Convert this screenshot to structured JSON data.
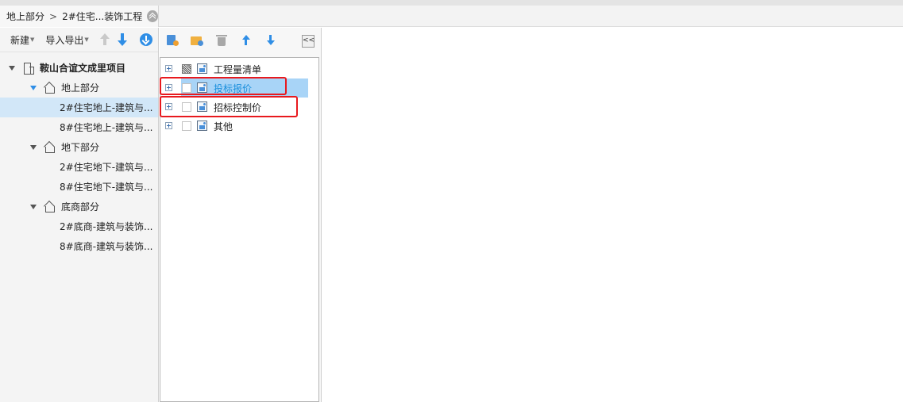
{
  "breadcrumb": {
    "root": "地上部分",
    "separator": ">",
    "current": "2#住宅...装饰工程",
    "collapse_icon": "double-chevron-up-icon"
  },
  "left_toolbar": {
    "new_label": "新建",
    "import_export_label": "导入导出",
    "move_up_icon": "arrow-up-icon",
    "move_down_icon": "arrow-down-icon",
    "download_icon": "download-circle-icon"
  },
  "project_tree": {
    "root": "鞍山合谊文成里项目",
    "groups": [
      {
        "label": "地上部分",
        "children": [
          "2#住宅地上-建筑与...",
          "8#住宅地上-建筑与..."
        ]
      },
      {
        "label": "地下部分",
        "children": [
          "2#住宅地下-建筑与...",
          "8#住宅地下-建筑与..."
        ]
      },
      {
        "label": "底商部分",
        "children": [
          "2#底商-建筑与装饰...",
          "8#底商-建筑与装饰..."
        ]
      }
    ],
    "selected": "2#住宅地上-建筑与..."
  },
  "mid_toolbar": {
    "icons": [
      "new-list-icon",
      "new-folder-icon",
      "trash-icon",
      "arrow-up-icon",
      "arrow-down-icon"
    ],
    "collapse_label": "<<"
  },
  "doc_list": {
    "items": [
      {
        "label": "工程量清单",
        "state": "partial"
      },
      {
        "label": "投标报价",
        "state": "selected"
      },
      {
        "label": "招标控制价",
        "state": "unchecked"
      },
      {
        "label": "其他",
        "state": "unchecked"
      }
    ]
  },
  "colors": {
    "accent_blue": "#2f8ee6",
    "selection_blue": "#a8d4f7",
    "tree_selection": "#d2e7f8",
    "highlight_red": "#e8191e"
  }
}
